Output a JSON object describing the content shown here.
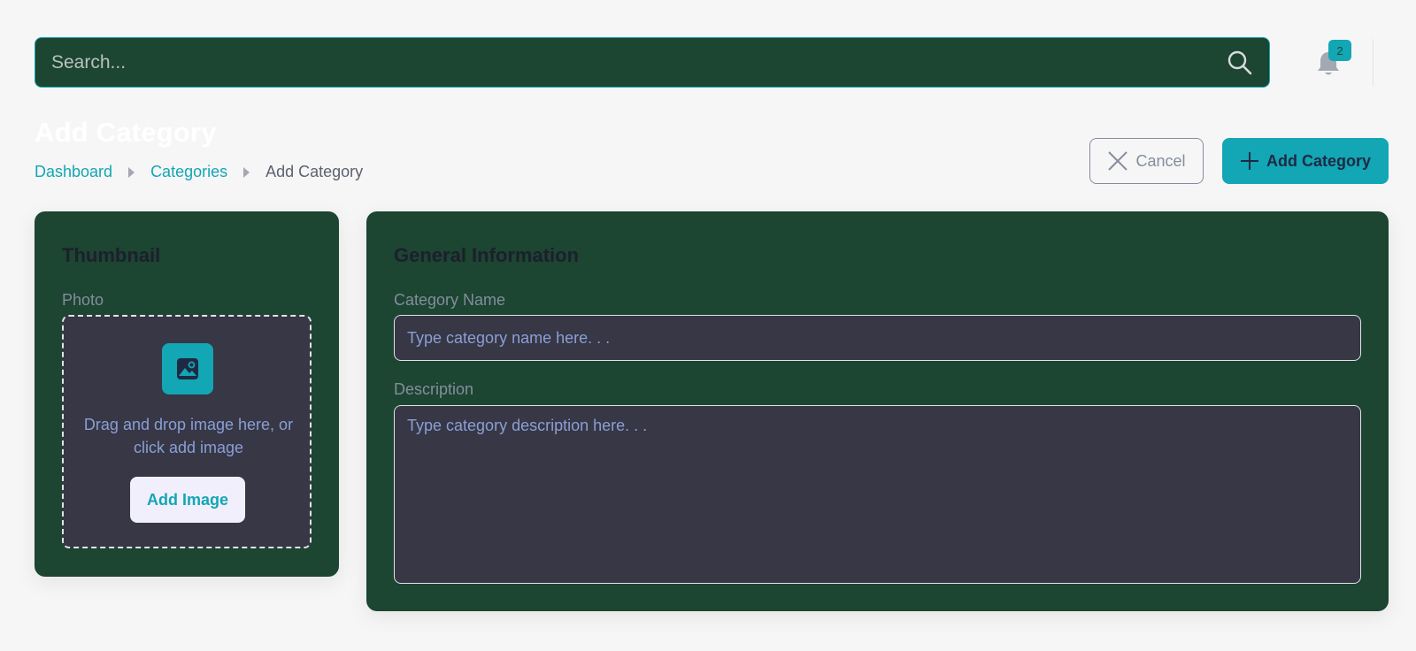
{
  "search": {
    "placeholder": "Search..."
  },
  "notifications": {
    "count": "2"
  },
  "header": {
    "title": "Add Category",
    "breadcrumb": [
      {
        "label": "Dashboard"
      },
      {
        "label": "Categories"
      },
      {
        "label": "Add Category"
      }
    ],
    "cancel_label": "Cancel",
    "add_label": "Add Category"
  },
  "thumbnail": {
    "title": "Thumbnail",
    "photo_label": "Photo",
    "drop_text": "Drag and drop image here, or click add image",
    "add_image_label": "Add Image"
  },
  "general": {
    "title": "General Information",
    "name_label": "Category Name",
    "name_placeholder": "Type category name here. . .",
    "description_label": "Description",
    "description_placeholder": "Type category description here. . ."
  },
  "colors": {
    "accent": "#13a6b4",
    "panel": "#1c4532",
    "field": "#373745",
    "background": "#f6f6f6"
  },
  "icons": [
    "search-icon",
    "bell-icon",
    "close-icon",
    "plus-icon",
    "image-icon"
  ]
}
